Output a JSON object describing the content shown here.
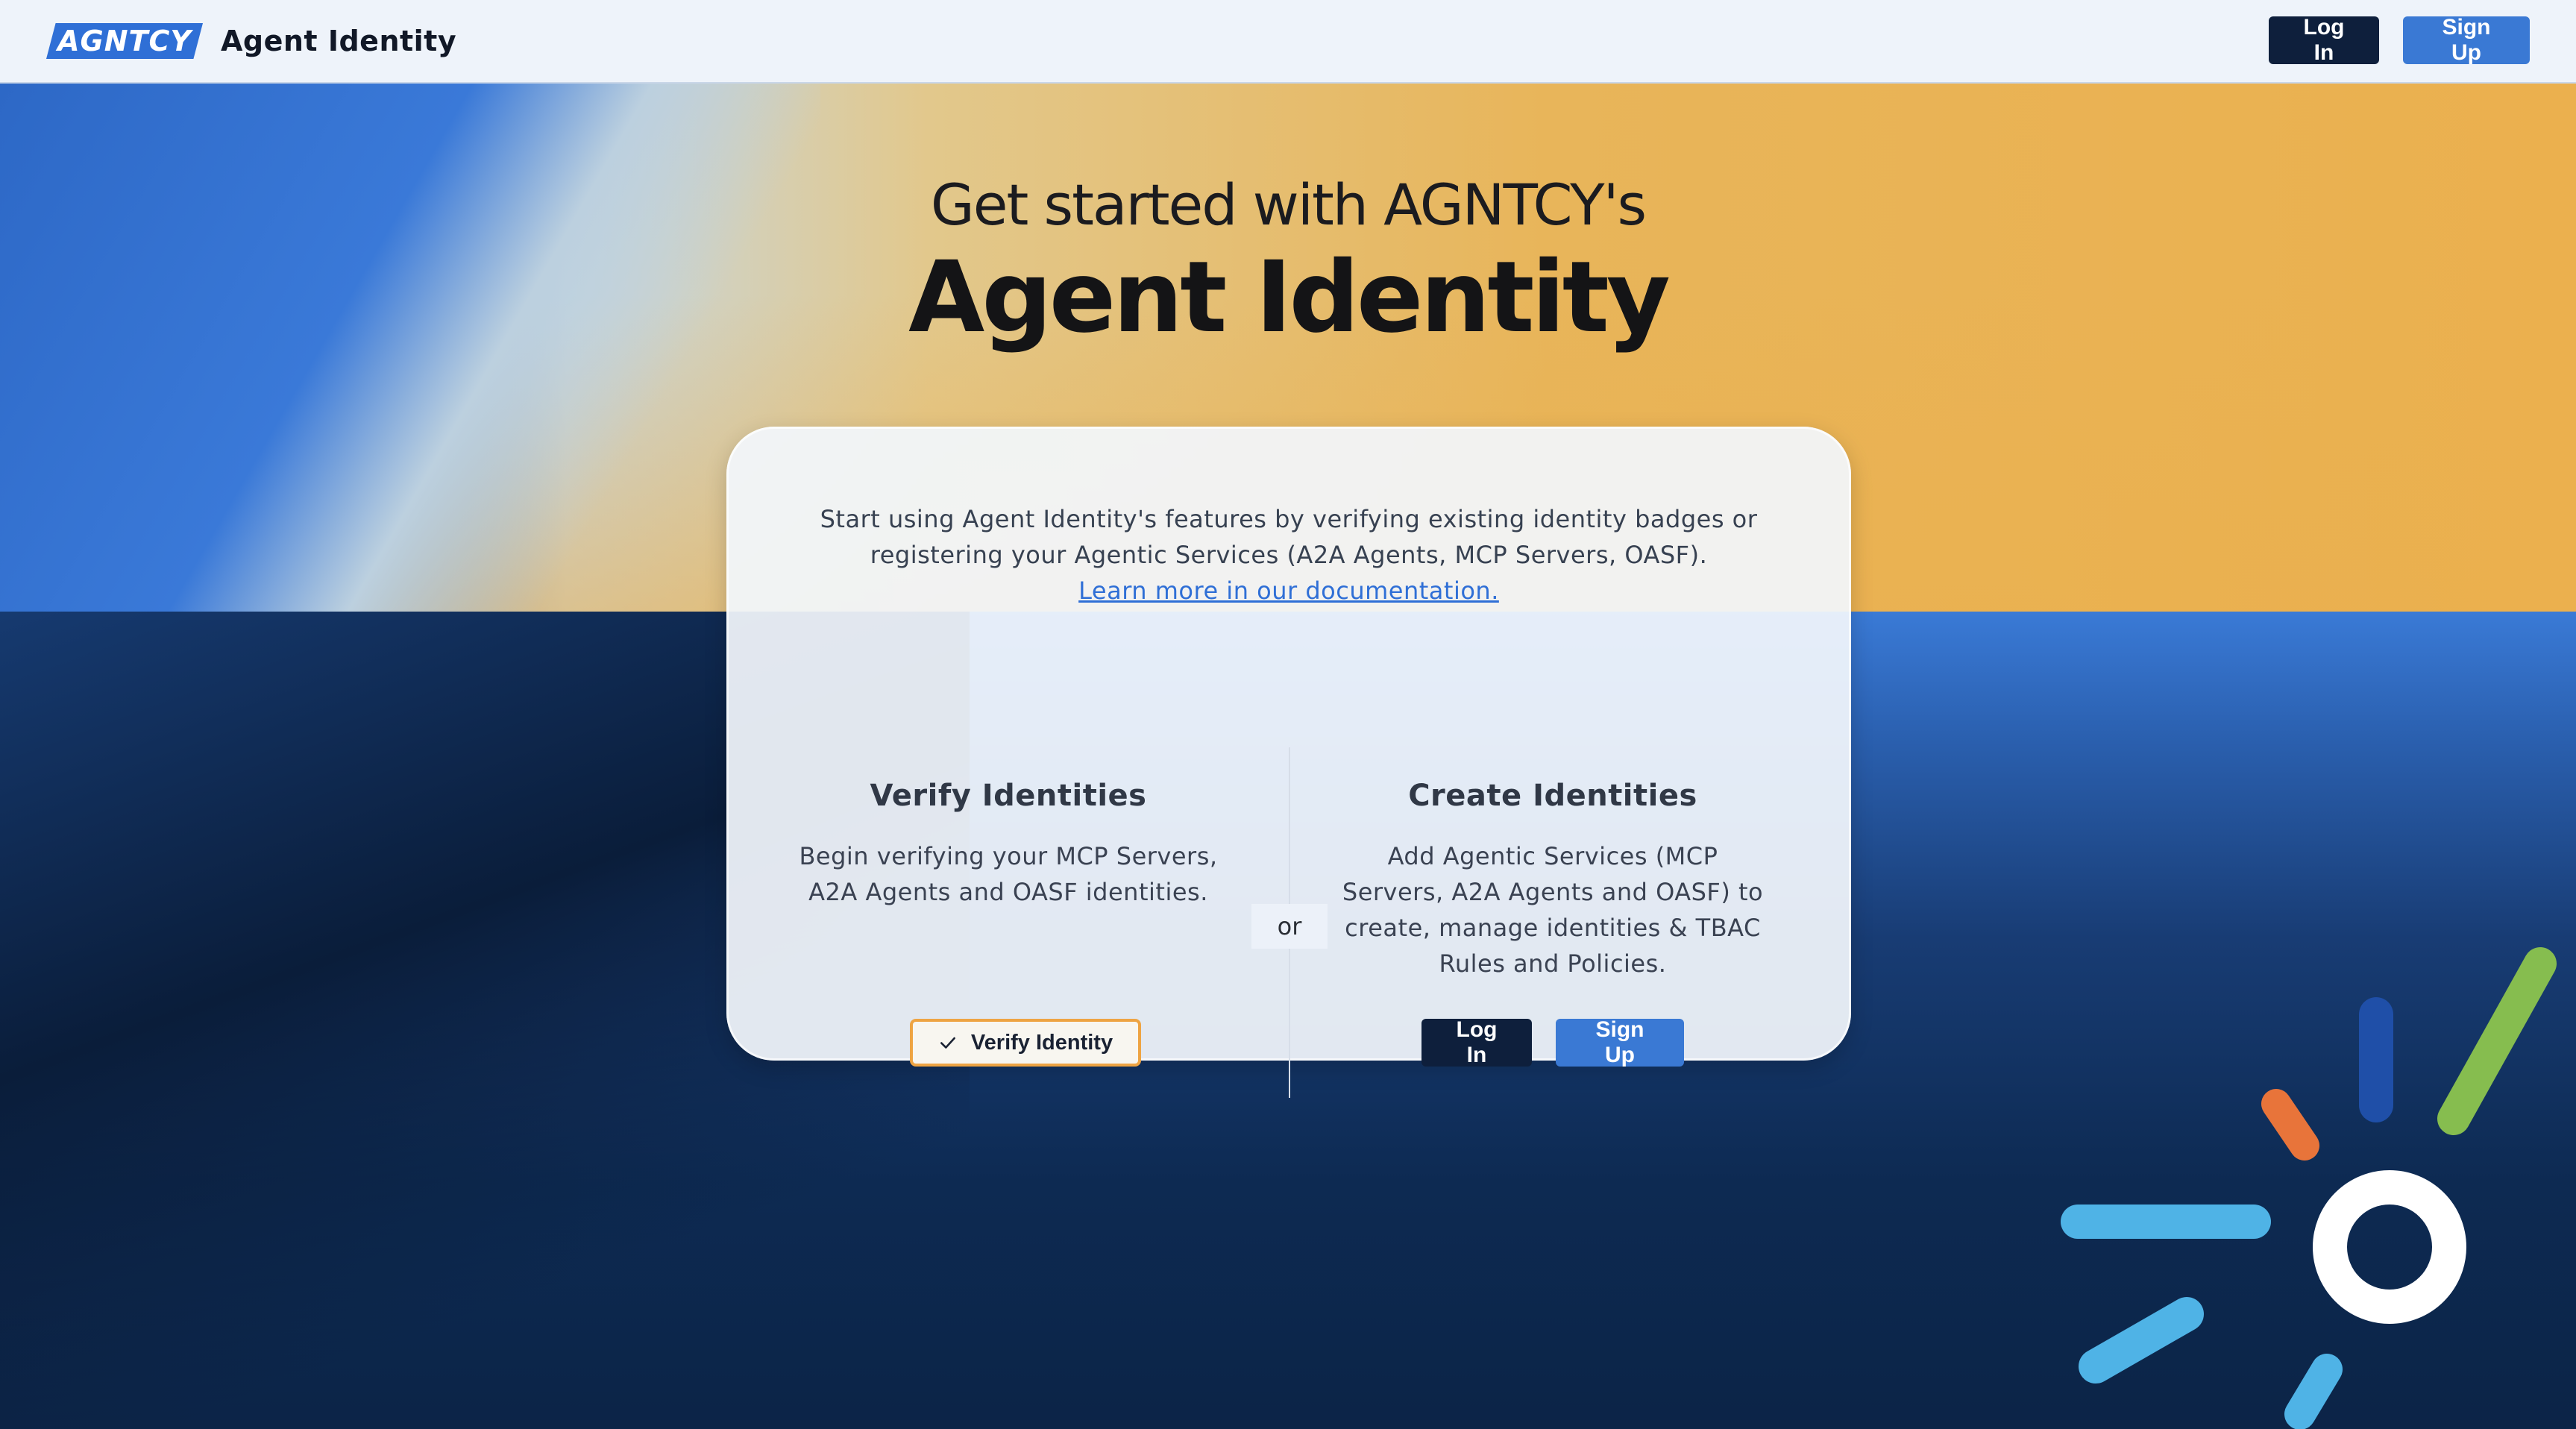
{
  "header": {
    "logo_text": "AGNTCY",
    "app_title": "Agent Identity",
    "login_label": "Log In",
    "signup_label": "Sign Up"
  },
  "hero": {
    "subtitle": "Get started with AGNTCY's",
    "title": "Agent Identity"
  },
  "card": {
    "intro_line1": "Start using Agent Identity's features by verifying existing identity badges or",
    "intro_line2": "registering your Agentic Services (A2A Agents, MCP Servers, OASF).",
    "doc_link": "Learn more in our documentation.",
    "or_label": "or",
    "verify": {
      "heading": "Verify Identities",
      "description_line1": "Begin verifying your MCP Servers,",
      "description_line2": "A2A Agents and OASF identities.",
      "button_label": "Verify Identity"
    },
    "create": {
      "heading": "Create Identities",
      "description_line1": "Add Agentic Services (MCP",
      "description_line2": "Servers, A2A Agents and OASF) to",
      "description_line3": "create, manage identities & TBAC",
      "description_line4": "Rules and Policies.",
      "login_label": "Log In",
      "signup_label": "Sign Up"
    }
  },
  "colors": {
    "brand_blue": "#2f6fd6",
    "dark_navy": "#0e1f3c",
    "button_blue": "#3a79d4",
    "accent_orange": "#eea443",
    "burst_green": "#86bd4f",
    "burst_blue_dark": "#1f4fa8",
    "burst_orange": "#e8743a",
    "burst_cyan": "#4fb3e6"
  }
}
